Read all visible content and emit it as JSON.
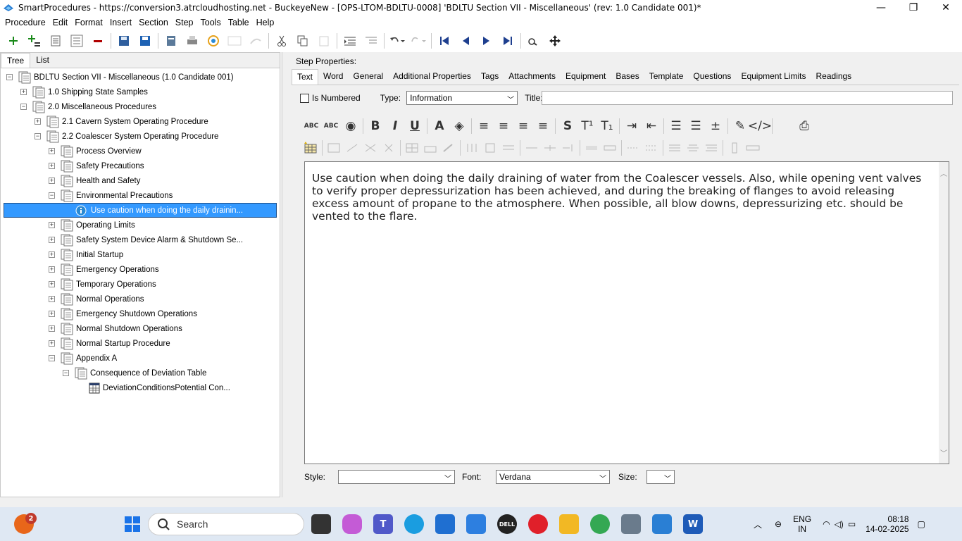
{
  "window": {
    "title": "SmartProcedures - https://conversion3.atrcloudhosting.net - BuckeyeNew - [OPS-LTOM-BDLTU-0008] 'BDLTU Section VII - Miscellaneous' (rev: 1.0 Candidate 001)*",
    "minimize_glyph": "—",
    "restore_glyph": "❐",
    "close_glyph": "✕"
  },
  "menu": [
    "Procedure",
    "Edit",
    "Format",
    "Insert",
    "Section",
    "Step",
    "Tools",
    "Table",
    "Help"
  ],
  "toolbar": {
    "icons": [
      "add-step-icon",
      "add-substep-icon",
      "document-icon",
      "document-alt-icon",
      "remove-icon",
      "save-all-icon",
      "save-icon",
      "publish-icon",
      "print-icon",
      "refresh-icon",
      "form-icon",
      "redirect-icon",
      "cut-icon",
      "copy-icon",
      "paste-icon",
      "indent-icon",
      "outdent-icon",
      "undo-icon",
      "redo-icon",
      "first-icon",
      "previous-icon",
      "next-icon",
      "last-icon",
      "find-icon",
      "move-icon"
    ]
  },
  "left_tabs": [
    "Tree",
    "List"
  ],
  "tree": [
    {
      "label": "BDLTU Section VII - Miscellaneous (1.0 Candidate 001)",
      "level": 0,
      "expander": "−"
    },
    {
      "label": "1.0 Shipping State Samples",
      "level": 1,
      "expander": "+"
    },
    {
      "label": "2.0 Miscellaneous Procedures",
      "level": 1,
      "expander": "−"
    },
    {
      "label": "2.1 Cavern System Operating Procedure",
      "level": 2,
      "expander": "+"
    },
    {
      "label": "2.2 Coalescer System Operating Procedure",
      "level": 2,
      "expander": "−"
    },
    {
      "label": "Process Overview",
      "level": 3,
      "expander": "+"
    },
    {
      "label": "Safety Precautions",
      "level": 3,
      "expander": "+"
    },
    {
      "label": "Health and Safety",
      "level": 3,
      "expander": "+"
    },
    {
      "label": "Environmental Precautions",
      "level": 3,
      "expander": "−"
    },
    {
      "label": "Use caution when doing the daily drainin...",
      "level": 4,
      "expander": "",
      "selected": true
    },
    {
      "label": "Operating Limits",
      "level": 3,
      "expander": "+"
    },
    {
      "label": "Safety System Device Alarm & Shutdown Se...",
      "level": 3,
      "expander": "+"
    },
    {
      "label": "Initial Startup",
      "level": 3,
      "expander": "+"
    },
    {
      "label": "Emergency Operations",
      "level": 3,
      "expander": "+"
    },
    {
      "label": "Temporary Operations",
      "level": 3,
      "expander": "+"
    },
    {
      "label": "Normal Operations",
      "level": 3,
      "expander": "+"
    },
    {
      "label": "Emergency Shutdown Operations",
      "level": 3,
      "expander": "+"
    },
    {
      "label": "Normal Shutdown Operations",
      "level": 3,
      "expander": "+"
    },
    {
      "label": "Normal Startup Procedure",
      "level": 3,
      "expander": "+"
    },
    {
      "label": "Appendix A",
      "level": 3,
      "expander": "−"
    },
    {
      "label": "Consequence of Deviation Table",
      "level": 4,
      "expander": "−"
    },
    {
      "label": "DeviationConditionsPotential Con...",
      "level": 5,
      "expander": "",
      "table": true
    }
  ],
  "step_properties": {
    "label": "Step Properties:",
    "tabs": [
      "Text",
      "Word",
      "General",
      "Additional Properties",
      "Tags",
      "Attachments",
      "Equipment",
      "Bases",
      "Template",
      "Questions",
      "Equipment Limits",
      "Readings"
    ],
    "is_numbered_label": "Is Numbered",
    "type_label": "Type:",
    "type_value": "Information",
    "title_label": "Title:",
    "title_value": "",
    "format_buttons": [
      "ABC",
      "ABC",
      "◉",
      "B",
      "I",
      "U",
      "A",
      "◈",
      "≡",
      "≡",
      "≡",
      "≡",
      "S",
      "T¹",
      "T₁",
      "⇥",
      "⇤",
      "☰",
      "☰",
      "±",
      "✎",
      "</>",
      "",
      "⎙"
    ],
    "body_text": "Use caution when doing the daily draining of water from the Coalescer vessels. Also, while opening vent valves to verify proper depressurization has been achieved, and during the breaking of flanges to avoid releasing excess amount of propane to the atmosphere. When possible, all blow downs, depressurizing etc. should be vented to the flare.",
    "style_label": "Style:",
    "style_value": "",
    "font_label": "Font:",
    "font_value": "Verdana",
    "size_label": "Size:",
    "size_value": ""
  },
  "taskbar": {
    "search_placeholder": "Search",
    "notification_count": "2",
    "language": "ENG",
    "region": "IN",
    "time": "08:18",
    "date": "14-02-2025"
  }
}
